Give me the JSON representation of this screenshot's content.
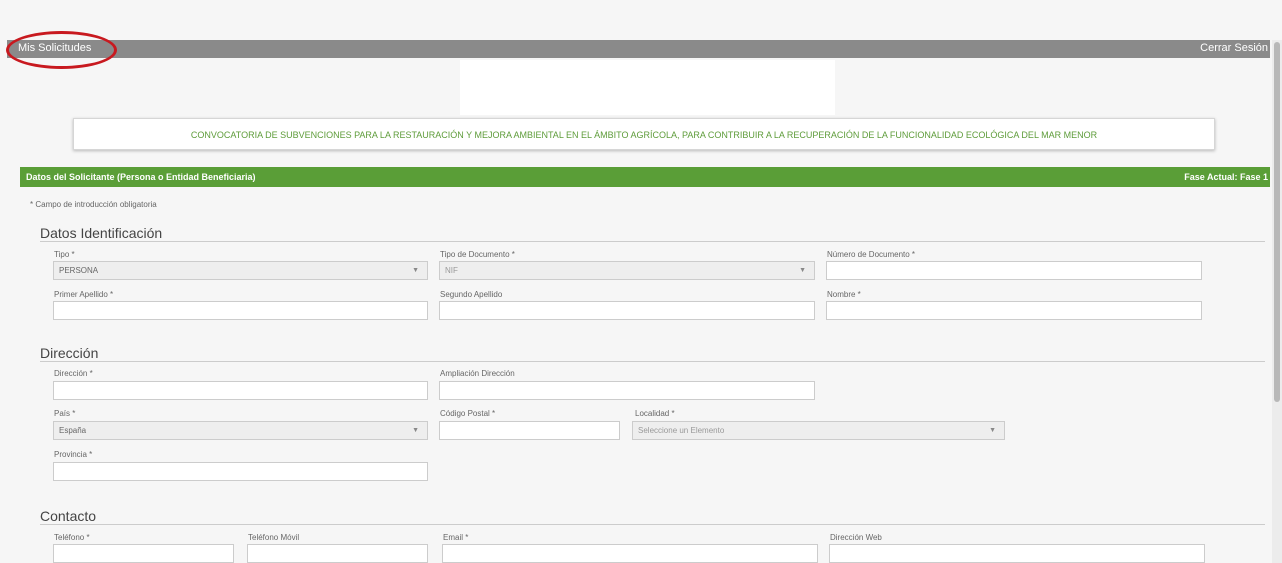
{
  "topbar": {
    "left_label": "Mis Solicitudes",
    "right_label": "Cerrar Sesión"
  },
  "convocatoria": "CONVOCATORIA DE SUBVENCIONES PARA LA RESTAURACIÓN Y MEJORA AMBIENTAL EN EL ÁMBITO AGRÍCOLA, PARA CONTRIBUIR A LA RECUPERACIÓN DE LA FUNCIONALIDAD ECOLÓGICA DEL MAR MENOR",
  "section_bar": {
    "title": "Datos del Solicitante (Persona o Entidad Beneficiaria)",
    "phase": "Fase Actual: Fase 1"
  },
  "mandatory_note": "* Campo de introducción obligatoria",
  "identificacion": {
    "title": "Datos Identificación",
    "tipo_label": "Tipo *",
    "tipo_value": "PERSONA",
    "tipo_doc_label": "Tipo de Documento *",
    "tipo_doc_value": "NIF",
    "num_doc_label": "Número de Documento *",
    "apellido1_label": "Primer Apellido *",
    "apellido2_label": "Segundo Apellido",
    "nombre_label": "Nombre *"
  },
  "direccion": {
    "title": "Dirección",
    "direccion_label": "Dirección *",
    "ampliacion_label": "Ampliación Dirección",
    "pais_label": "País *",
    "pais_value": "España",
    "cp_label": "Código Postal *",
    "localidad_label": "Localidad *",
    "localidad_value": "Seleccione un Elemento",
    "provincia_label": "Provincia *"
  },
  "contacto": {
    "title": "Contacto",
    "telefono_label": "Teléfono *",
    "movil_label": "Teléfono Móvil",
    "email_label": "Email *",
    "web_label": "Dirección Web"
  },
  "icons": {
    "dropdown": "chevron-down-icon"
  }
}
